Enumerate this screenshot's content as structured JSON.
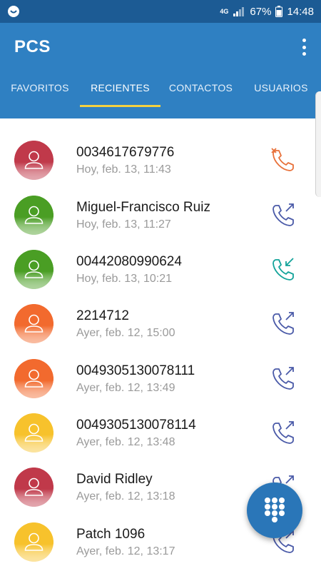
{
  "status_bar": {
    "network": "4G",
    "battery_percent": "67%",
    "time": "14:48",
    "icons": [
      "app-notification-icon",
      "signal-icon",
      "battery-icon"
    ]
  },
  "app": {
    "title": "PCS",
    "menu_icon": "more-vert-icon"
  },
  "tabs": [
    {
      "label": "FAVORITOS",
      "active": false
    },
    {
      "label": "RECIENTES",
      "active": true
    },
    {
      "label": "CONTACTOS",
      "active": false
    },
    {
      "label": "USUARIOS",
      "active": false
    }
  ],
  "calls": [
    {
      "name": "0034617679776",
      "time": "Hoy, feb. 13, 11:43",
      "type": "missed",
      "avatar_color": "#c0394a",
      "icon": "missed-call-icon"
    },
    {
      "name": "Miguel-Francisco Ruiz",
      "time": "Hoy, feb. 13, 11:27",
      "type": "outgoing",
      "avatar_color": "#4a9e24",
      "icon": "outgoing-call-icon"
    },
    {
      "name": "00442080990624",
      "time": "Hoy, feb. 13, 10:21",
      "type": "incoming",
      "avatar_color": "#4a9e24",
      "icon": "incoming-call-icon"
    },
    {
      "name": "2214712",
      "time": "Ayer, feb. 12, 15:00",
      "type": "outgoing",
      "avatar_color": "#f26a2e",
      "icon": "outgoing-call-icon"
    },
    {
      "name": "0049305130078111",
      "time": "Ayer, feb. 12, 13:49",
      "type": "outgoing",
      "avatar_color": "#f26a2e",
      "icon": "outgoing-call-icon"
    },
    {
      "name": "0049305130078114",
      "time": "Ayer, feb. 12, 13:48",
      "type": "outgoing",
      "avatar_color": "#f7c22c",
      "icon": "outgoing-call-icon"
    },
    {
      "name": "David Ridley",
      "time": "Ayer, feb. 12, 13:18",
      "type": "outgoing",
      "avatar_color": "#c0394a",
      "icon": "outgoing-call-icon"
    },
    {
      "name": "Patch 1096",
      "time": "Ayer, feb. 12, 13:17",
      "type": "outgoing",
      "avatar_color": "#f7c22c",
      "icon": "outgoing-call-icon"
    }
  ],
  "colors": {
    "app_bar": "#2f80c2",
    "status_bar": "#1c5b94",
    "tab_indicator": "#f4d03f",
    "missed_call": "#e8713a",
    "outgoing_call": "#4a5aa8",
    "incoming_call": "#13a39a",
    "fab": "#2a76b8"
  },
  "fab": {
    "icon": "dialpad-icon"
  }
}
